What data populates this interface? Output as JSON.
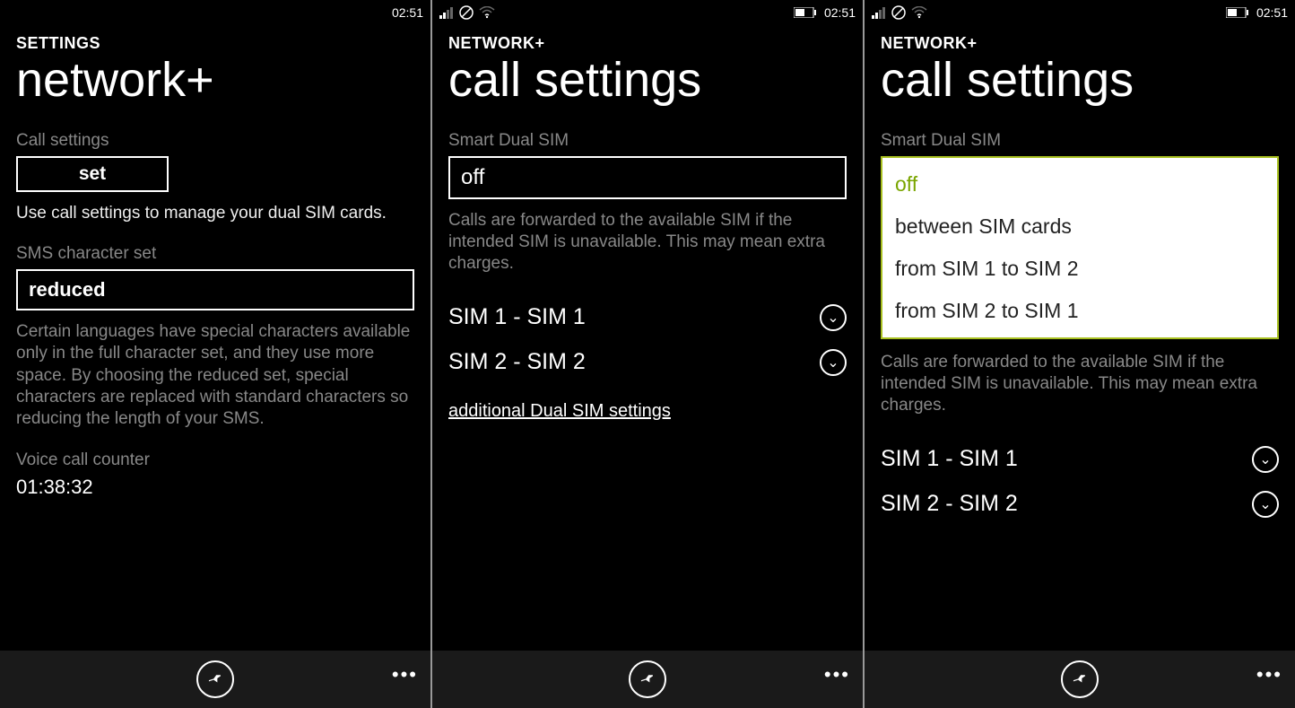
{
  "statusbar": {
    "time": "02:51"
  },
  "screens": [
    {
      "eyebrow": "SETTINGS",
      "title": "network+",
      "call_settings_label": "Call settings",
      "set_button": "set",
      "call_settings_desc": "Use call settings to manage your dual SIM cards.",
      "sms_label": "SMS character set",
      "sms_value": "reduced",
      "sms_desc": "Certain languages have special characters available only in the full character set, and they use more space. By choosing the reduced set, special characters are replaced with standard characters so reducing the length of your SMS.",
      "voice_label": "Voice call counter",
      "voice_value": "01:38:32"
    },
    {
      "eyebrow": "NETWORK+",
      "title": "call settings",
      "smart_label": "Smart Dual SIM",
      "smart_value": "off",
      "smart_desc": "Calls are forwarded to the available SIM if the intended SIM is unavailable. This may mean extra charges.",
      "sim1": "SIM 1 - SIM 1",
      "sim2": "SIM 2 - SIM 2",
      "additional": "additional Dual SIM settings"
    },
    {
      "eyebrow": "NETWORK+",
      "title": "call settings",
      "smart_label": "Smart Dual SIM",
      "options": [
        "off",
        "between SIM cards",
        "from SIM 1 to SIM 2",
        "from SIM 2 to SIM 1"
      ],
      "selected": "off",
      "smart_desc": "Calls are forwarded to the available SIM if the intended SIM is unavailable. This may mean extra charges.",
      "sim1": "SIM 1 - SIM 1",
      "sim2": "SIM 2 - SIM 2"
    }
  ]
}
